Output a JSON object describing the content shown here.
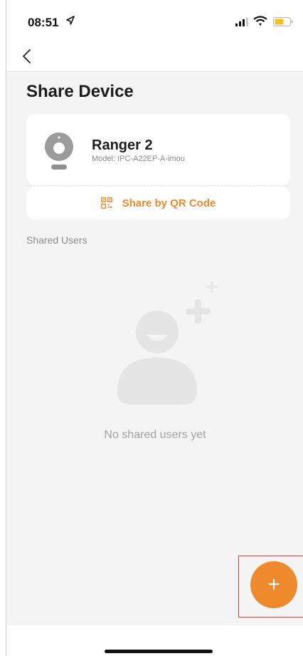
{
  "status_bar": {
    "time": "08:51",
    "icons": [
      "location-arrow-icon",
      "cellular-signal-icon",
      "wifi-icon",
      "battery-icon"
    ]
  },
  "nav": {
    "back_icon": "chevron-left-icon"
  },
  "page": {
    "title": "Share Device"
  },
  "device": {
    "name": "Ranger 2",
    "model": "Model:  IPC-A22EP-A-imou",
    "icon": "camera-icon"
  },
  "qr": {
    "label": "Share by QR Code",
    "icon": "qr-code-icon"
  },
  "shared": {
    "section_label": "Shared Users",
    "empty_text": "No shared users yet",
    "empty_icon": "add-user-illustration-icon"
  },
  "fab": {
    "label": "+",
    "icon": "plus-icon"
  },
  "colors": {
    "accent": "#ef8a2c",
    "background": "#f4f4f4",
    "card": "#ffffff",
    "highlight_border": "#e53935"
  }
}
